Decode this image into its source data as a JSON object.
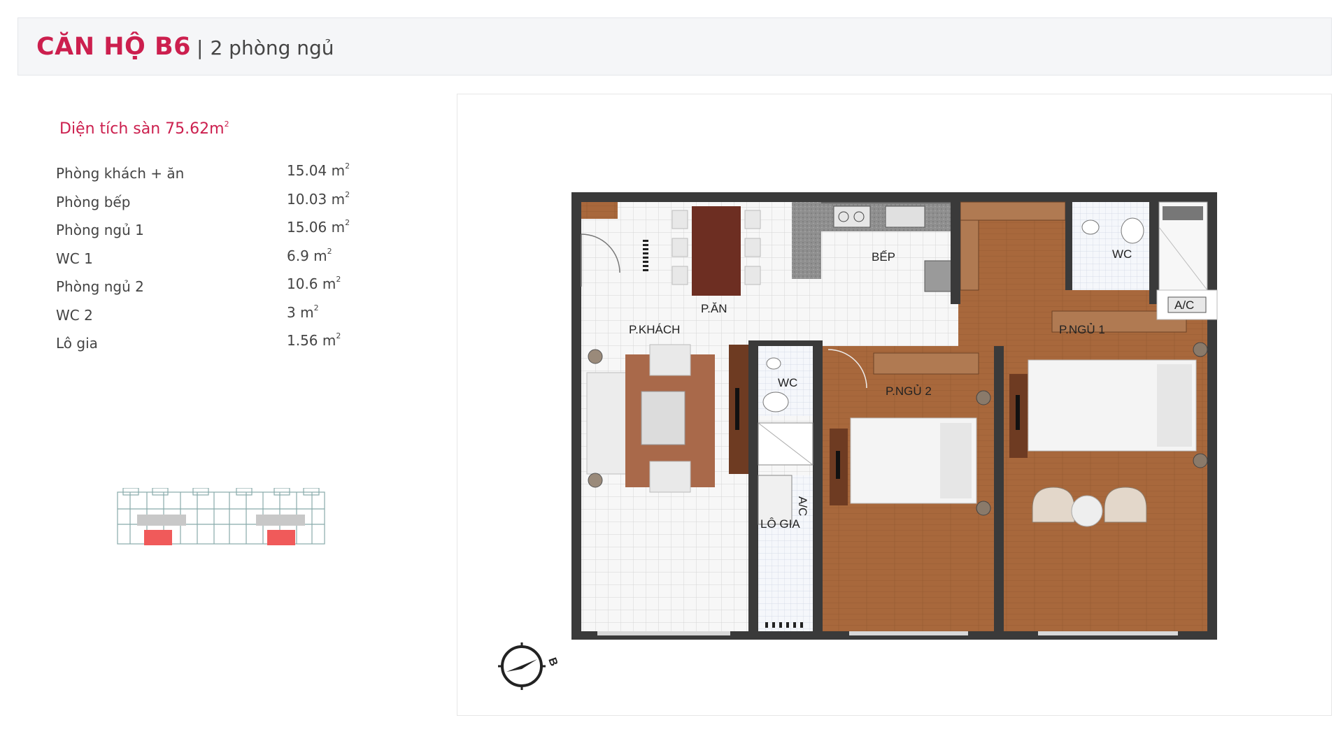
{
  "header": {
    "title": "CĂN HỘ B6",
    "separator": "|",
    "subtitle": "2 phòng ngủ"
  },
  "area": {
    "label": "Diện tích sàn 75.62m",
    "unit_sup": "2"
  },
  "rooms": [
    {
      "name": "Phòng khách + ăn",
      "value": "15.04 m",
      "sup": "2"
    },
    {
      "name": "Phòng bếp",
      "value": "10.03 m",
      "sup": "2"
    },
    {
      "name": "Phòng ngủ 1",
      "value": "15.06 m",
      "sup": "2"
    },
    {
      "name": "WC 1",
      "value": "6.9 m",
      "sup": "2"
    },
    {
      "name": "Phòng ngủ 2",
      "value": "10.6 m",
      "sup": "2"
    },
    {
      "name": "WC 2",
      "value": "3 m",
      "sup": "2"
    },
    {
      "name": "Lô gia",
      "value": "1.56 m",
      "sup": "2"
    }
  ],
  "plan_labels": {
    "kitchen": "BẾP",
    "dining": "P.ĂN",
    "living": "P.KHÁCH",
    "wc_top": "WC",
    "wc_center": "WC",
    "bedroom1": "P.NGỦ 1",
    "bedroom2": "P.NGỦ 2",
    "loggia": "LÔ GIA",
    "ac_top": "A/C",
    "ac_side": "A/C"
  },
  "compass": {
    "letter": "B"
  },
  "colors": {
    "accent": "#cc1f4e",
    "wood": "#a8683c",
    "wall": "#3a3a3a",
    "tile": "#f3f3f3",
    "highlight": "#f05a5a"
  }
}
